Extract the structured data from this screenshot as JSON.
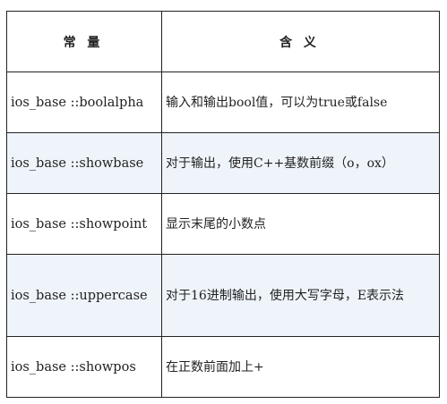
{
  "table": {
    "headers": [
      "常 量",
      "含 义"
    ],
    "rows": [
      {
        "constant": "ios_base ::boolalpha",
        "meaning": "输入和输出bool值，可以为true或false"
      },
      {
        "constant": "ios_base ::showbase",
        "meaning": "对于输出，使用C++基数前缀（o，ox）"
      },
      {
        "constant": "ios_base ::showpoint",
        "meaning": "显示末尾的小数点"
      },
      {
        "constant": "ios_base ::uppercase",
        "meaning": "对于16进制输出，使用大写字母，E表示法"
      },
      {
        "constant": "ios_base ::showpos",
        "meaning": "在正数前面加上+"
      }
    ]
  },
  "colors": {
    "shade": "#eff4fb",
    "border": "#222222"
  }
}
